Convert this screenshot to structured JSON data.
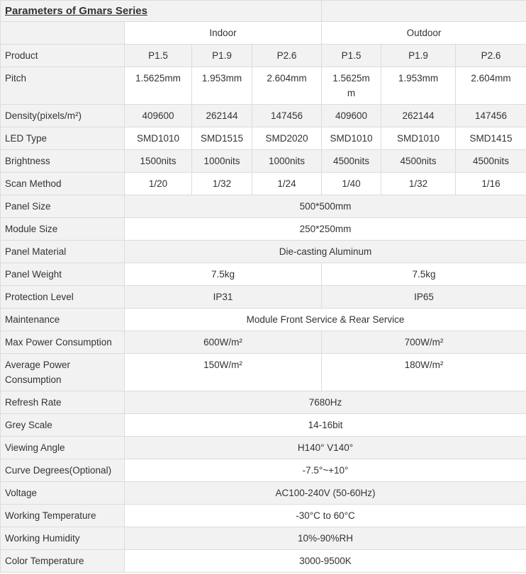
{
  "title": "Parameters of Gmars Series",
  "groups": {
    "indoor": "Indoor",
    "outdoor": "Outdoor"
  },
  "rows": {
    "product": {
      "label": "Product",
      "values": [
        "P1.5",
        "P1.9",
        "P2.6",
        "P1.5",
        "P1.9",
        "P2.6"
      ]
    },
    "pitch": {
      "label": "Pitch",
      "values": [
        "1.5625mm",
        "1.953mm",
        "2.604mm",
        "1.5625m\nm",
        "1.953mm",
        "2.604mm"
      ]
    },
    "density": {
      "label": "Density(pixels/m²)",
      "values": [
        "409600",
        "262144",
        "147456",
        "409600",
        "262144",
        "147456"
      ]
    },
    "led_type": {
      "label": "LED Type",
      "values": [
        "SMD1010",
        "SMD1515",
        "SMD2020",
        "SMD1010",
        "SMD1010",
        "SMD1415"
      ]
    },
    "brightness": {
      "label": "Brightness",
      "values": [
        "1500nits",
        "1000nits",
        "1000nits",
        "4500nits",
        "4500nits",
        "4500nits"
      ]
    },
    "scan": {
      "label": "Scan Method",
      "values": [
        "1/20",
        "1/32",
        "1/24",
        "1/40",
        "1/32",
        "1/16"
      ]
    },
    "panel_size": {
      "label": "Panel Size",
      "value": "500*500mm"
    },
    "module_size": {
      "label": "Module Size",
      "value": "250*250mm"
    },
    "panel_material": {
      "label": "Panel Material",
      "value": "Die-casting Aluminum"
    },
    "panel_weight": {
      "label": "Panel Weight",
      "indoor": "7.5kg",
      "outdoor": "7.5kg"
    },
    "protection": {
      "label": "Protection Level",
      "indoor": "IP31",
      "outdoor": "IP65"
    },
    "maintenance": {
      "label": "Maintenance",
      "value": "Module Front Service & Rear Service"
    },
    "max_power": {
      "label": "Max Power Consumption",
      "indoor": "600W/m²",
      "outdoor": "700W/m²"
    },
    "avg_power": {
      "label": "Average Power Consumption",
      "indoor": "150W/m²",
      "outdoor": "180W/m²"
    },
    "refresh": {
      "label": "Refresh Rate",
      "value": "7680Hz"
    },
    "grey": {
      "label": "Grey Scale",
      "value": "14-16bit"
    },
    "viewing": {
      "label": "Viewing Angle",
      "value": "H140° V140°"
    },
    "curve": {
      "label": "Curve Degrees(Optional)",
      "value": "-7.5°~+10°"
    },
    "voltage": {
      "label": "Voltage",
      "value": "AC100-240V (50-60Hz)"
    },
    "working_temp": {
      "label": "Working Temperature",
      "value": "-30°C to 60°C"
    },
    "working_humidity": {
      "label": "Working Humidity",
      "value": "10%-90%RH"
    },
    "color_temp": {
      "label": "Color Temperature",
      "value": "3000-9500K"
    }
  }
}
